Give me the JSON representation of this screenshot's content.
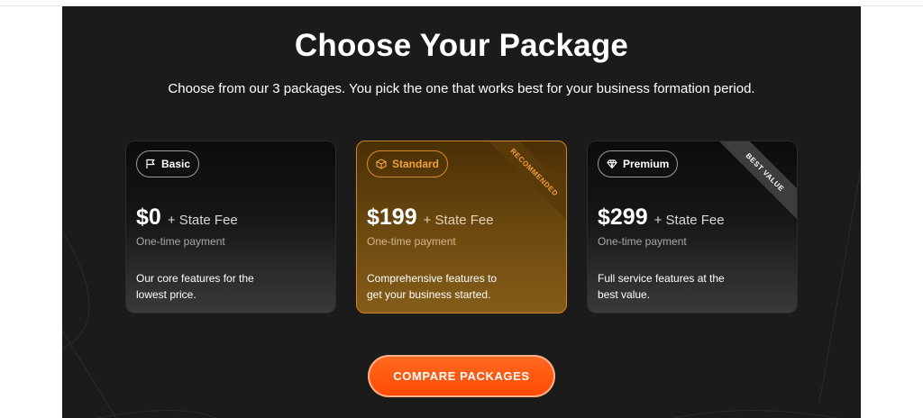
{
  "header": {
    "title": "Choose Your Package",
    "subtitle": "Choose from our 3 packages. You pick the one that works best for your business formation period."
  },
  "packages": [
    {
      "name": "Basic",
      "icon": "flag-icon",
      "price": "$0",
      "fee": "+ State Fee",
      "payment": "One-time payment",
      "description": "Our core features for the lowest price.",
      "ribbon": ""
    },
    {
      "name": "Standard",
      "icon": "cube-icon",
      "price": "$199",
      "fee": "+ State Fee",
      "payment": "One-time payment",
      "description": "Comprehensive features to get your business started.",
      "ribbon": "RECOMMENDED"
    },
    {
      "name": "Premium",
      "icon": "diamond-icon",
      "price": "$299",
      "fee": "+ State Fee",
      "payment": "One-time payment",
      "description": "Full service features at the best value.",
      "ribbon": "BEST VALUE"
    }
  ],
  "cta": {
    "label": "COMPARE PACKAGES"
  },
  "colors": {
    "background": "#1c1b1b",
    "accent": "#ff5a10",
    "standard_border": "#c8872a"
  }
}
